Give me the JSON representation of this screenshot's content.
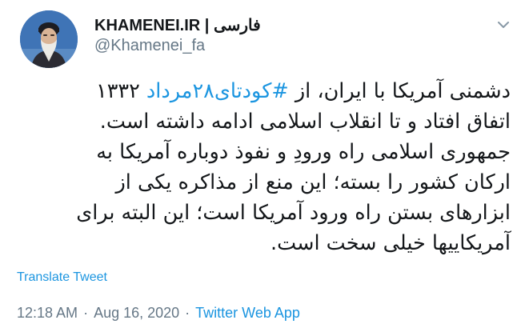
{
  "author": {
    "display_name": "KHAMENEI.IR | فارسی",
    "handle": "@Khamenei_fa"
  },
  "tweet": {
    "lines": [
      {
        "pre": "دشمنی آمریکا با ایران، از ",
        "hashtag": "#کودتای۲۸مرداد",
        "post": " ۱۳۳۲"
      },
      {
        "pre": "اتفاق افتاد و تا انقلاب اسلامی ادامه داشته است.",
        "hashtag": "",
        "post": ""
      },
      {
        "pre": "جمهوری اسلامی راه ورودِ و نفوذ دوباره آمریکا به",
        "hashtag": "",
        "post": ""
      },
      {
        "pre": "ارکان کشور را بسته؛ این منع از مذاکره یکی از",
        "hashtag": "",
        "post": ""
      },
      {
        "pre": "ابزارهای بستن راه ورود آمریکا است؛ این البته برای",
        "hashtag": "",
        "post": ""
      },
      {
        "pre": "آمریکاییها خیلی سخت است.",
        "hashtag": "",
        "post": ""
      }
    ],
    "translate_label": "Translate Tweet",
    "time": "12:18 AM",
    "separator": "·",
    "date": "Aug 16, 2020",
    "source": "Twitter Web App"
  },
  "icons": {
    "avatar": "profile-photo",
    "menu": "chevron-down-icon"
  },
  "colors": {
    "link": "#1b95e0",
    "text": "#14171a",
    "muted": "#657786"
  }
}
